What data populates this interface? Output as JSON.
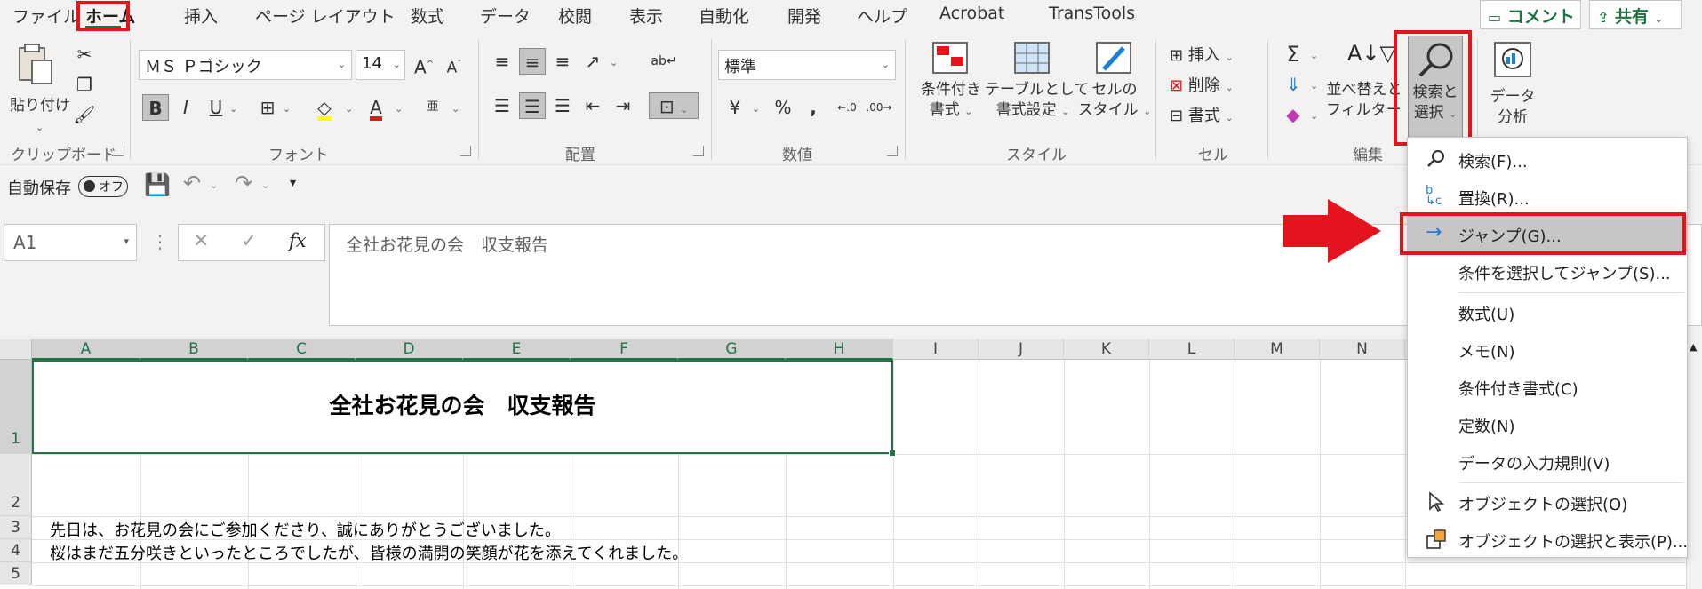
{
  "tabs": [
    "ファイル",
    "ホーム",
    "挿入",
    "ページ レイアウト",
    "数式",
    "データ",
    "校閲",
    "表示",
    "自動化",
    "開発",
    "ヘルプ",
    "Acrobat",
    "TransTools"
  ],
  "top_buttons": {
    "comment": "コメント",
    "share": "共有"
  },
  "ribbon": {
    "clipboard": {
      "paste": "貼り付け",
      "label": "クリップボード"
    },
    "font": {
      "name": "ＭＳ Ｐゴシック",
      "size": "14",
      "bold": "B",
      "italic": "I",
      "underline": "U",
      "grow": "A",
      "shrink": "A",
      "furigana": "亜",
      "label": "フォント"
    },
    "align": {
      "label": "配置"
    },
    "number": {
      "format": "標準",
      "label": "数値"
    },
    "style": {
      "cond": "条件付き\n書式",
      "cond1": "条件付き",
      "cond2": "書式",
      "table1": "テーブルとして",
      "table2": "書式設定",
      "cell1": "セルの",
      "cell2": "スタイル",
      "label": "スタイル"
    },
    "cells": {
      "insert": "挿入",
      "delete": "削除",
      "format": "書式",
      "label": "セル"
    },
    "edit": {
      "sort1": "並べ替えと",
      "sort2": "フィルター",
      "find1": "検索と",
      "find2": "選択",
      "label": "編集"
    },
    "analysis": {
      "l1": "データ",
      "l2": "分析"
    }
  },
  "qat": {
    "autosave": "自動保存",
    "toggle": "オフ"
  },
  "formula_bar": {
    "name_box": "A1",
    "content": "全社お花見の会　収支報告"
  },
  "columns": [
    "A",
    "B",
    "C",
    "D",
    "E",
    "F",
    "G",
    "H",
    "I",
    "J",
    "K",
    "L",
    "M",
    "N"
  ],
  "rows": [
    "1",
    "2",
    "3",
    "4",
    "5"
  ],
  "cells": {
    "title": "全社お花見の会　収支報告",
    "row3": "先日は、お花見の会にご参加くださり、誠にありがとうございました。",
    "row4": "桜はまだ五分咲きといったところでしたが、皆様の満開の笑顔が花を添えてくれました。"
  },
  "menu": [
    {
      "label": "検索(F)...",
      "icon": "search-icon"
    },
    {
      "label": "置換(R)...",
      "icon": "replace-icon"
    },
    {
      "label": "ジャンプ(G)...",
      "icon": "arrow-right-icon"
    },
    {
      "label": "条件を選択してジャンプ(S)...",
      "icon": ""
    },
    {
      "label": "数式(U)",
      "icon": ""
    },
    {
      "label": "メモ(N)",
      "icon": ""
    },
    {
      "label": "条件付き書式(C)",
      "icon": ""
    },
    {
      "label": "定数(N)",
      "icon": ""
    },
    {
      "label": "データの入力規則(V)",
      "icon": ""
    },
    {
      "label": "オブジェクトの選択(O)",
      "icon": "cursor-icon"
    },
    {
      "label": "オブジェクトの選択と表示(P)...",
      "icon": "selection-pane-icon"
    }
  ],
  "colors": {
    "accent": "#217346",
    "highlight": "#e3141d"
  }
}
